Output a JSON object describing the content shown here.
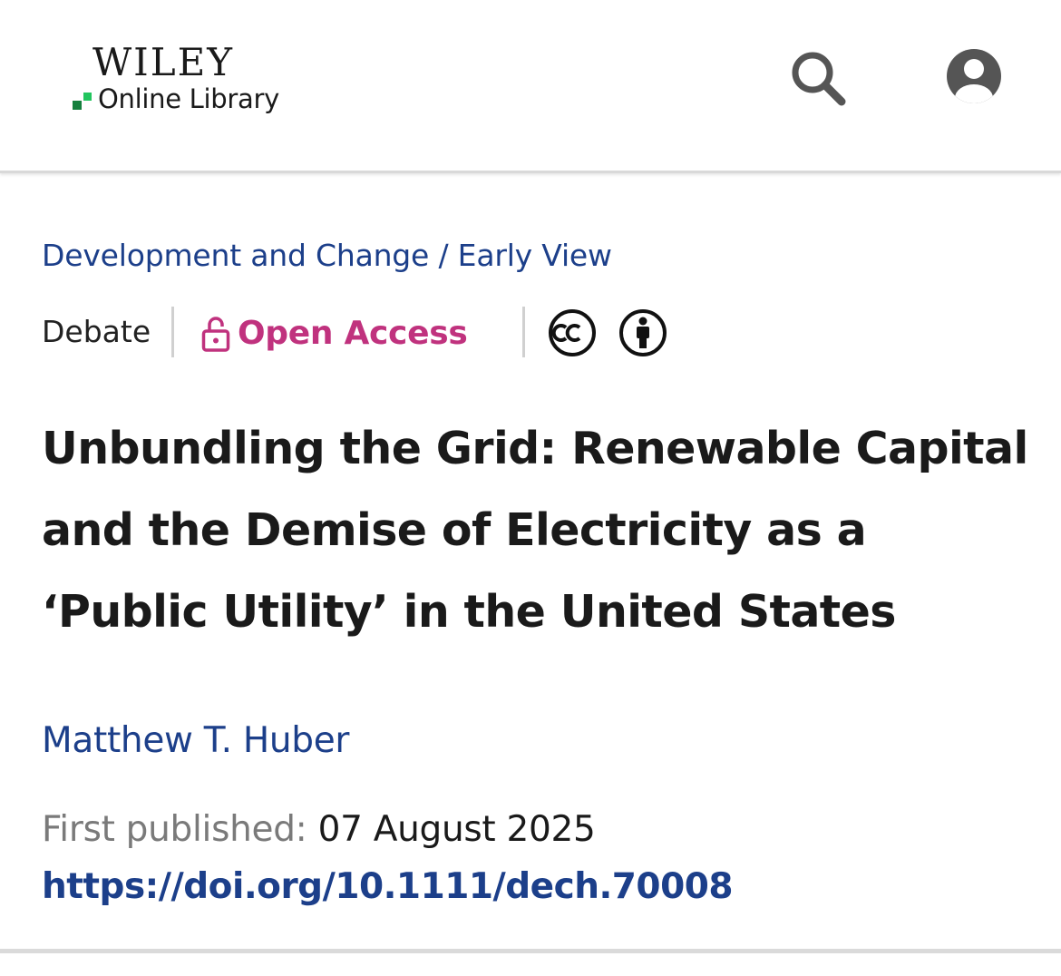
{
  "header": {
    "logo_wordmark": "WILEY",
    "logo_subtitle": "Online Library",
    "search_icon": "search-icon",
    "account_icon": "account-icon"
  },
  "article": {
    "journal": "Development and Change",
    "breadcrumb_separator": " / ",
    "issue_status": "Early View",
    "article_type": "Debate",
    "access_label": "Open Access",
    "access_icon": "open-lock-icon",
    "license_icons": [
      "creative-commons-icon",
      "attribution-icon"
    ],
    "title": "Unbundling the Grid: Renewable Capital and the Demise of Electricity as a ‘Public Utility’ in the United States",
    "author": "Matthew T. Huber",
    "first_published_label": "First published:",
    "first_published_date": "07 August 2025",
    "doi_url": "https://doi.org/10.1111/dech.70008"
  },
  "colors": {
    "link_blue": "#1c3f8a",
    "open_access_magenta": "#c0327e",
    "muted_gray": "#7a7a7a",
    "icon_gray": "#555555",
    "logo_green_dark": "#15803d",
    "logo_green_light": "#22c55e"
  }
}
